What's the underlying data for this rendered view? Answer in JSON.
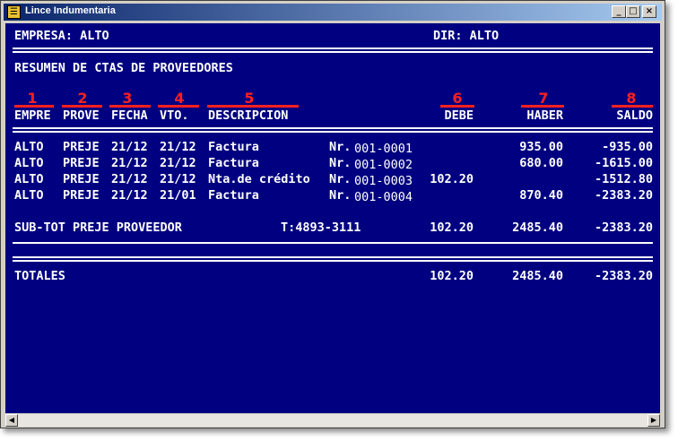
{
  "window": {
    "title": "Lince Indumentaria",
    "minimize": "_",
    "maximize": "□",
    "close": "×"
  },
  "report": {
    "empresa": "EMPRESA: ALTO",
    "dir": "DIR: ALTO",
    "heading": "RESUMEN DE CTAS DE PROVEEDORES",
    "markers": [
      "1",
      "2",
      "3",
      "4",
      "5",
      "6",
      "7",
      "8"
    ],
    "columns": {
      "empre": "EMPRE",
      "prove": "PROVE",
      "fecha": "FECHA",
      "vto": "VTO.",
      "descripcion": "DESCRIPCION",
      "debe": "DEBE",
      "haber": "HABER",
      "saldo": "SALDO"
    },
    "rows": [
      {
        "empre": "ALTO",
        "prove": "PREJE",
        "fecha": "21/12",
        "vto": "21/12",
        "desc": "Factura",
        "nr": "Nr.",
        "doc": "001-0001",
        "debe": "",
        "haber": "935.00",
        "saldo": "-935.00"
      },
      {
        "empre": "ALTO",
        "prove": "PREJE",
        "fecha": "21/12",
        "vto": "21/12",
        "desc": "Factura",
        "nr": "Nr.",
        "doc": "001-0002",
        "debe": "",
        "haber": "680.00",
        "saldo": "-1615.00"
      },
      {
        "empre": "ALTO",
        "prove": "PREJE",
        "fecha": "21/12",
        "vto": "21/12",
        "desc": "Nta.de crédito",
        "nr": "Nr.",
        "doc": "001-0003",
        "debe": "102.20",
        "haber": "",
        "saldo": "-1512.80"
      },
      {
        "empre": "ALTO",
        "prove": "PREJE",
        "fecha": "21/12",
        "vto": "21/01",
        "desc": "Factura",
        "nr": "Nr.",
        "doc": "001-0004",
        "debe": "",
        "haber": "870.40",
        "saldo": "-2383.20"
      }
    ],
    "subtotal": {
      "label": "SUB-TOT PREJE PROVEEDOR",
      "phone": "T:4893-3111",
      "debe": "102.20",
      "haber": "2485.40",
      "saldo": "-2383.20"
    },
    "totals": {
      "label": "TOTALES",
      "debe": "102.20",
      "haber": "2485.40",
      "saldo": "-2383.20"
    }
  },
  "scrollbar": {
    "left": "◀",
    "right": "▶"
  }
}
